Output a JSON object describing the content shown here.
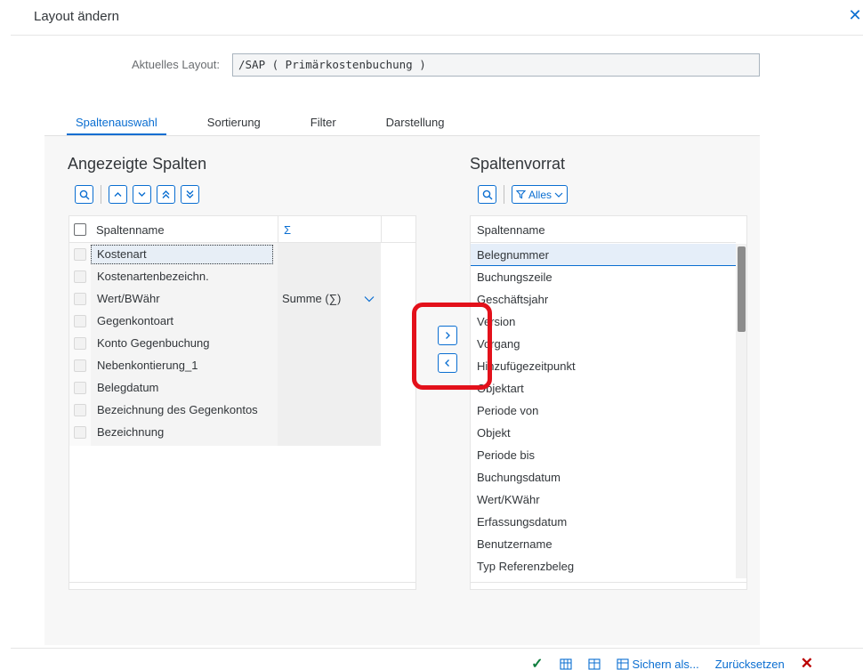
{
  "dialog": {
    "title": "Layout ändern"
  },
  "layout": {
    "label": "Aktuelles Layout:",
    "value": "/SAP ( Primärkostenbuchung )"
  },
  "tabs": [
    {
      "label": "Spaltenauswahl",
      "active": true
    },
    {
      "label": "Sortierung",
      "active": false
    },
    {
      "label": "Filter",
      "active": false
    },
    {
      "label": "Darstellung",
      "active": false
    }
  ],
  "left": {
    "title": "Angezeigte Spalten",
    "col_name": "Spaltenname",
    "col_sum": "Σ",
    "rows": [
      {
        "name": "Kostenart",
        "sum": ""
      },
      {
        "name": "Kostenartenbezeichn.",
        "sum": ""
      },
      {
        "name": "Wert/BWähr",
        "sum": "Summe (∑)"
      },
      {
        "name": "Gegenkontoart",
        "sum": ""
      },
      {
        "name": "Konto Gegenbuchung",
        "sum": ""
      },
      {
        "name": "Nebenkontierung_1",
        "sum": ""
      },
      {
        "name": "Belegdatum",
        "sum": ""
      },
      {
        "name": "Bezeichnung des Gegenkontos",
        "sum": ""
      },
      {
        "name": "Bezeichnung",
        "sum": ""
      }
    ]
  },
  "right": {
    "title": "Spaltenvorrat",
    "filter_label": "Alles",
    "col_name": "Spaltenname",
    "rows": [
      "Belegnummer",
      "Buchungszeile",
      "Geschäftsjahr",
      "Version",
      "Vorgang",
      "Hinzufügezeitpunkt",
      "Objektart",
      "Periode von",
      "Objekt",
      "Periode bis",
      "Buchungsdatum",
      "Wert/KWähr",
      "Erfassungsdatum",
      "Benutzername",
      "Typ Referenzbeleg"
    ]
  },
  "footer": {
    "save_as": "Sichern als...",
    "reset": "Zurücksetzen"
  },
  "colors": {
    "accent": "#0a6ed1",
    "highlight": "#e3111b",
    "ok": "#107e3e",
    "cancel": "#bb0000"
  }
}
